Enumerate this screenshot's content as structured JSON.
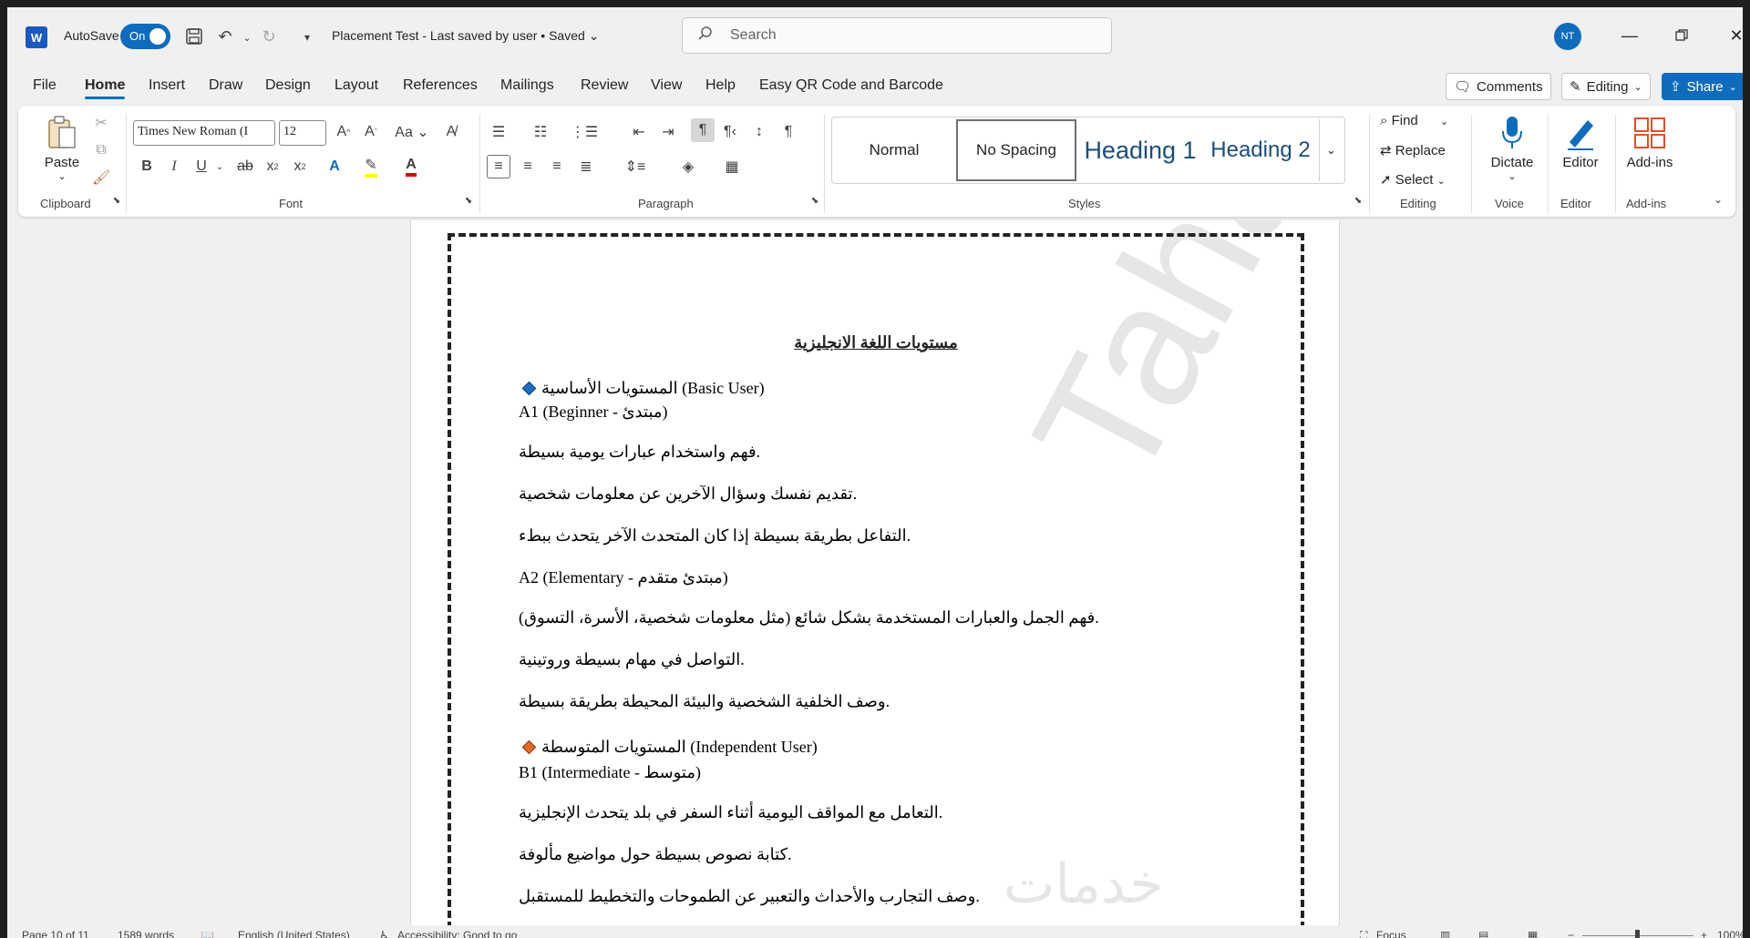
{
  "app": {
    "autosave_label": "AutoSave",
    "autosave_state": "On",
    "doc_title": "Placement Test  -  Last saved by user  •  Saved",
    "search_placeholder": "Search",
    "user_initials": "NT",
    "accent": "#0f6cbd"
  },
  "menu": {
    "items": [
      "File",
      "Home",
      "Insert",
      "Draw",
      "Design",
      "Layout",
      "References",
      "Mailings",
      "Review",
      "View",
      "Help",
      "Easy QR Code and Barcode"
    ],
    "active": "Home",
    "comments_label": "Comments",
    "editing_label": "Editing",
    "share_label": "Share"
  },
  "ribbon": {
    "clipboard": {
      "paste_label": "Paste",
      "group_label": "Clipboard"
    },
    "font": {
      "font_name": "Times New Roman (I",
      "font_size": "12",
      "group_label": "Font"
    },
    "paragraph": {
      "group_label": "Paragraph"
    },
    "styles": {
      "group_label": "Styles",
      "tiles": [
        "Normal",
        "No Spacing",
        "Heading 1",
        "Heading 2"
      ]
    },
    "editing": {
      "find": "Find",
      "replace": "Replace",
      "select": "Select",
      "group_label": "Editing"
    },
    "voice": {
      "dictate": "Dictate",
      "group_label": "Voice"
    },
    "editor": {
      "label": "Editor",
      "group_label": "Editor"
    },
    "addins": {
      "label": "Add-ins",
      "group_label": "Add-ins"
    }
  },
  "document": {
    "title": "مستويات اللغة الانجليزية",
    "lines": [
      "المستويات الأساسية (Basic User)",
      "A1 (Beginner - مبتدئ)",
      "فهم واستخدام عبارات يومية بسيطة.",
      "تقديم نفسك وسؤال الآخرين عن معلومات شخصية.",
      "التفاعل بطريقة بسيطة إذا كان المتحدث الآخر يتحدث ببطء.",
      "A2 (Elementary - مبتدئ متقدم)",
      "فهم الجمل والعبارات المستخدمة بشكل شائع (مثل معلومات شخصية، الأسرة، التسوق).",
      "التواصل في مهام بسيطة وروتينية.",
      "وصف الخلفية الشخصية والبيئة المحيطة بطريقة بسيطة.",
      "المستويات المتوسطة (Independent User)",
      "B1 (Intermediate - متوسط)",
      "التعامل مع المواقف اليومية أثناء السفر في بلد يتحدث الإنجليزية.",
      "كتابة نصوص بسيطة حول مواضيع مألوفة.",
      "وصف التجارب والأحداث والتعبير عن الطموحات والتخطيط للمستقبل."
    ],
    "bullet_colors": [
      "#1e6fc0",
      "#e06a2a"
    ],
    "watermark": "Taha Tarek",
    "watermark_ar": "خدمات"
  },
  "status": {
    "page": "Page 10 of 11",
    "words": "1589 words",
    "language": "English (United States)",
    "accessibility": "Accessibility: Good to go",
    "focus": "Focus",
    "zoom": "100%"
  }
}
